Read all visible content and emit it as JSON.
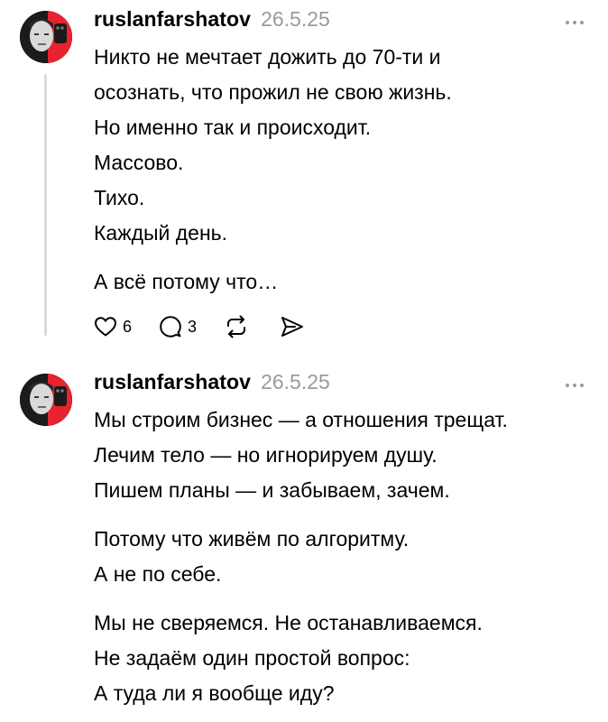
{
  "posts": [
    {
      "username": "ruslanfarshatov",
      "date": "26.5.25",
      "lines": [
        "Никто не мечтает дожить до 70-ти и",
        "осознать, что прожил не свою жизнь.",
        "Но именно так и происходит.",
        "Массово.",
        "Тихо.",
        "Каждый день.",
        "А всё потому что…"
      ],
      "likes": "6",
      "replies": "3"
    },
    {
      "username": "ruslanfarshatov",
      "date": "26.5.25",
      "lines": [
        "Мы строим бизнес — а отношения трещат.",
        "Лечим тело — но игнорируем душу.",
        "Пишем планы — и забываем, зачем.",
        "Потому что живём по алгоритму.",
        "А не по себе.",
        "Мы не сверяемся. Не останавливаемся.",
        "Не задаём один простой вопрос:",
        "А туда ли я вообще иду?"
      ]
    }
  ],
  "icons": {
    "more": "more-horizontal-icon",
    "like": "heart-icon",
    "reply": "comment-icon",
    "repost": "repost-icon",
    "share": "send-icon"
  },
  "colors": {
    "text": "#000000",
    "muted": "#9a9a9a",
    "thread_line": "#dbdbdb",
    "avatar_accent": "#e8222e"
  }
}
